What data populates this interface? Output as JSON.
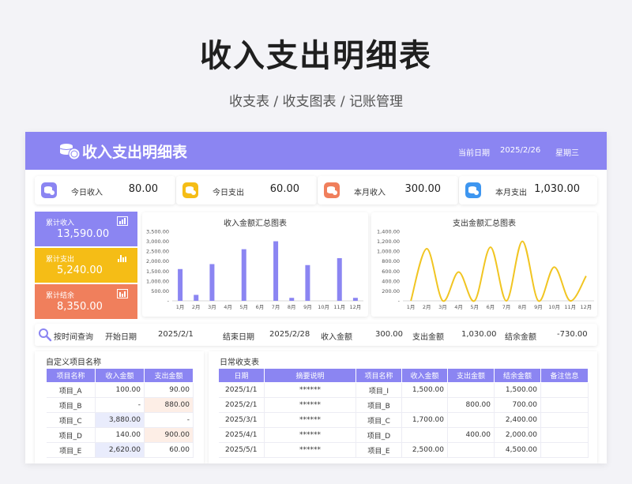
{
  "page": {
    "title": "收入支出明细表",
    "subtitle": "收支表 / 收支图表 / 记账管理"
  },
  "colors": {
    "accent": "#8b85f2",
    "yellow": "#f5bd16",
    "orange": "#f07f5c",
    "blue": "#3e96f0",
    "line": "#f1c522"
  },
  "header": {
    "title": "收入支出明细表",
    "date_label": "当前日期",
    "date_value": "2025/2/26",
    "weekday": "星期三",
    "icon": "coins-icon"
  },
  "stats": [
    {
      "label": "今日收入",
      "value": "80.00",
      "icon": "coins-icon"
    },
    {
      "label": "今日支出",
      "value": "60.00",
      "icon": "coins-icon"
    },
    {
      "label": "本月收入",
      "value": "300.00",
      "icon": "coins-icon"
    },
    {
      "label": "本月支出",
      "value": "1,030.00",
      "icon": "coins-icon"
    }
  ],
  "summary": [
    {
      "label": "累计收入",
      "value": "13,590.00",
      "icon": "bar-chart-icon"
    },
    {
      "label": "累计支出",
      "value": "5,240.00",
      "icon": "bar-chart-icon"
    },
    {
      "label": "累计结余",
      "value": "8,350.00",
      "icon": "bar-chart-icon"
    }
  ],
  "chart_data": [
    {
      "type": "bar",
      "title": "收入金额汇总图表",
      "categories": [
        "1月",
        "2月",
        "3月",
        "4月",
        "5月",
        "6月",
        "7月",
        "8月",
        "9月",
        "10月",
        "11月",
        "12月"
      ],
      "values": [
        1600,
        300,
        1850,
        0,
        2600,
        0,
        3000,
        150,
        1800,
        0,
        2150,
        150
      ],
      "ylim": [
        0,
        3500
      ],
      "yticks": [
        "-",
        "500.00",
        "1,000.00",
        "1,500.00",
        "2,000.00",
        "2,500.00",
        "3,000.00",
        "3,500.00"
      ],
      "grid": false
    },
    {
      "type": "line",
      "title": "支出金额汇总图表",
      "categories": [
        "1月",
        "2月",
        "3月",
        "4月",
        "5月",
        "6月",
        "7月",
        "8月",
        "9月",
        "10月",
        "11月",
        "12月"
      ],
      "values": [
        0,
        1050,
        0,
        580,
        0,
        1080,
        0,
        1200,
        0,
        680,
        0,
        500
      ],
      "ylim": [
        0,
        1400
      ],
      "yticks": [
        "-",
        "200.00",
        "400.00",
        "600.00",
        "800.00",
        "1,000.00",
        "1,200.00",
        "1,400.00"
      ],
      "grid": false
    }
  ],
  "query": {
    "label": "按时间查询",
    "icon": "search-icon",
    "start_label": "开始日期",
    "start_value": "2025/2/1",
    "end_label": "结束日期",
    "end_value": "2025/2/28",
    "income_label": "收入金额",
    "income_value": "300.00",
    "expense_label": "支出金额",
    "expense_value": "1,030.00",
    "balance_label": "结余金额",
    "balance_value": "-730.00"
  },
  "custom_items": {
    "title": "自定义项目名称",
    "headers": [
      "项目名称",
      "收入金额",
      "支出金额"
    ],
    "rows": [
      [
        "项目_A",
        "100.00",
        "90.00"
      ],
      [
        "项目_B",
        "-",
        "880.00"
      ],
      [
        "项目_C",
        "3,880.00",
        "-"
      ],
      [
        "项目_D",
        "140.00",
        "900.00"
      ],
      [
        "项目_E",
        "2,620.00",
        "60.00"
      ]
    ]
  },
  "daily": {
    "title": "日常收支表",
    "headers": [
      "日期",
      "摘要说明",
      "项目名称",
      "收入金额",
      "支出金额",
      "结余金额",
      "备注信息"
    ],
    "rows": [
      [
        "2025/1/1",
        "******",
        "项目_I",
        "1,500.00",
        "",
        "1,500.00",
        ""
      ],
      [
        "2025/2/1",
        "******",
        "项目_B",
        "",
        "800.00",
        "700.00",
        ""
      ],
      [
        "2025/3/1",
        "******",
        "项目_C",
        "1,700.00",
        "",
        "2,400.00",
        ""
      ],
      [
        "2025/4/1",
        "******",
        "项目_D",
        "",
        "400.00",
        "2,000.00",
        ""
      ],
      [
        "2025/5/1",
        "******",
        "项目_E",
        "2,500.00",
        "",
        "4,500.00",
        ""
      ]
    ]
  }
}
